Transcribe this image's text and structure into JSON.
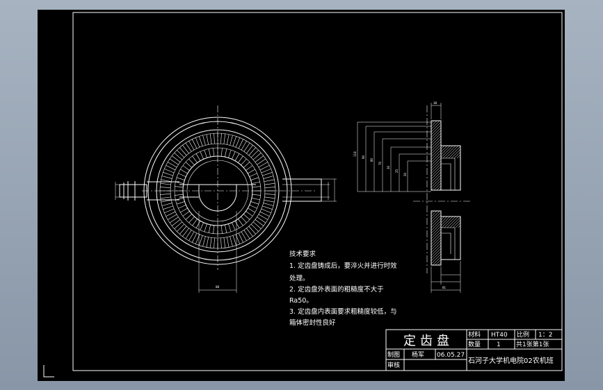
{
  "technical_requirements": {
    "heading": "技术要求",
    "lines": [
      "1. 定齿盘铸成后，要淬火并进行时效",
      "处理。",
      "2. 定齿盘外表面的粗糙度不大于",
      "Ra50。",
      "3. 定齿盘内表面要求粗糙度较低，与",
      "箱体密封性良好"
    ]
  },
  "title_block": {
    "part_name": "定齿盘",
    "material_label": "材料",
    "material_value": "HT40",
    "scale_label": "比例",
    "scale_value": "1：2",
    "quantity_label": "数量",
    "quantity_value": "1",
    "sheet_info": "共1张第1张",
    "drawn_label": "制图",
    "drawn_name": "杨军",
    "date": "06.05.27",
    "reviewed_label": "审核",
    "institution": "石河子大学机电院02农机班"
  },
  "dimensions": {
    "bottom_left": "88",
    "right_top": "38",
    "right_bottom": "81",
    "vertical_labels": [
      "118",
      "90",
      "80",
      "70",
      "30",
      "25",
      "20"
    ]
  }
}
